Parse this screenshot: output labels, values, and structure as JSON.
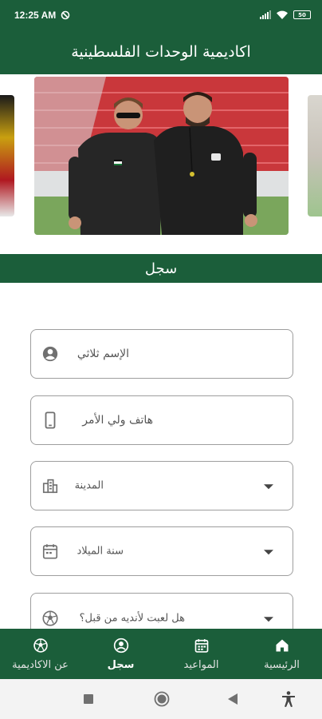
{
  "status_bar": {
    "time": "12:25 AM",
    "battery": "50"
  },
  "header": {
    "title": "اكاديمية الوحدات الفلسطينية"
  },
  "carousel": {
    "slides": [
      "slide-left",
      "slide-main",
      "slide-right"
    ]
  },
  "section": {
    "title": "سجل"
  },
  "form": {
    "fields": [
      {
        "label": "الإسم ثلاثي",
        "icon": "user-circle-icon",
        "type": "text"
      },
      {
        "label": "هاتف ولي الأمر",
        "icon": "phone-icon",
        "type": "text"
      },
      {
        "label": "المدينة",
        "icon": "city-icon",
        "type": "select"
      },
      {
        "label": "سنة الميلاد",
        "icon": "calendar-icon",
        "type": "select"
      },
      {
        "label": "هل لعبت لأنديه من قبل؟",
        "icon": "soccer-ball-icon",
        "type": "select"
      }
    ]
  },
  "bottom_nav": {
    "items": [
      {
        "label": "عن الاكاديمية",
        "icon": "soccer-ball-icon",
        "active": false
      },
      {
        "label": "سجل",
        "icon": "account-circle-icon",
        "active": true
      },
      {
        "label": "المواعيد",
        "icon": "calendar-icon",
        "active": false
      },
      {
        "label": "الرئيسية",
        "icon": "home-icon",
        "active": false
      }
    ]
  },
  "colors": {
    "primary": "#1b5e3a",
    "background": "#ffffff",
    "field_border": "#9e9e9e"
  }
}
